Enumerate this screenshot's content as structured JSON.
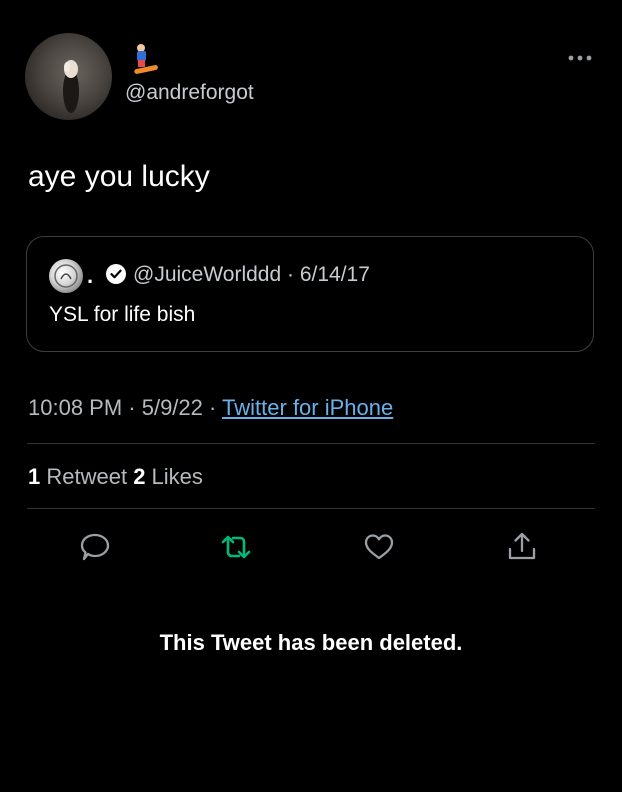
{
  "tweet": {
    "handle": "@andreforgot",
    "text": "aye you lucky",
    "name_emoji": "snowboarder-icon"
  },
  "quote": {
    "separator": ".",
    "meta": "@JuiceWorlddd · 6/14/17",
    "text": "YSL for life bish"
  },
  "details": {
    "time": "10:08 PM · 5/9/22 · ",
    "source": "Twitter for iPhone"
  },
  "stats": {
    "retweet_count": "1",
    "retweet_label": " Retweet ",
    "like_count": "2",
    "like_label": " Likes"
  },
  "status": {
    "message": "This Tweet has been deleted."
  },
  "colors": {
    "background": "#000000",
    "link": "#6ab0ea",
    "retweet_active": "#00ba7c",
    "muted": "#b6babe"
  },
  "icons": [
    "more-icon",
    "verified-icon",
    "reply-icon",
    "retweet-icon",
    "like-icon",
    "share-icon"
  ]
}
